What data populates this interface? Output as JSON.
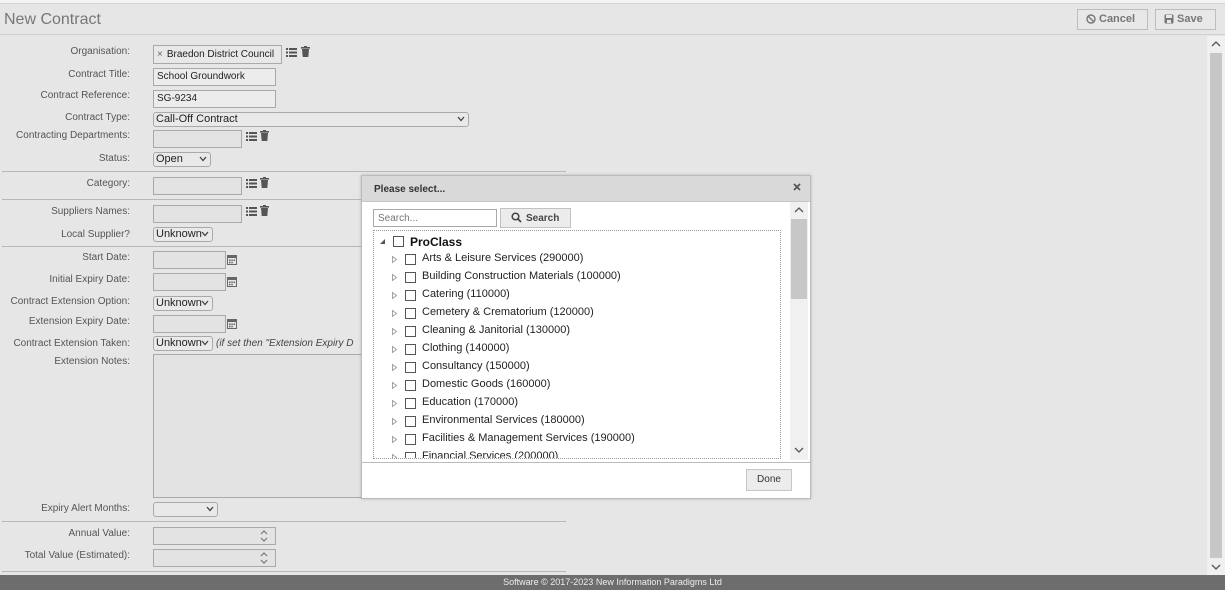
{
  "header": {
    "title": "New Contract",
    "cancel_label": "Cancel",
    "save_label": "Save"
  },
  "form": {
    "organisation": {
      "label": "Organisation:",
      "value": "Braedon District Council",
      "remove": "×"
    },
    "contract_title": {
      "label": "Contract Title:",
      "value": "School Groundwork"
    },
    "contract_reference": {
      "label": "Contract Reference:",
      "value": "SG-9234"
    },
    "contract_type": {
      "label": "Contract Type:",
      "value": "Call-Off Contract"
    },
    "contracting_departments": {
      "label": "Contracting Departments:",
      "value": ""
    },
    "status": {
      "label": "Status:",
      "value": "Open"
    },
    "category": {
      "label": "Category:",
      "value": ""
    },
    "suppliers_names": {
      "label": "Suppliers Names:",
      "value": ""
    },
    "local_supplier": {
      "label": "Local Supplier?",
      "value": "Unknown"
    },
    "start_date": {
      "label": "Start Date:",
      "value": ""
    },
    "initial_expiry_date": {
      "label": "Initial Expiry Date:",
      "value": ""
    },
    "contract_extension_option": {
      "label": "Contract Extension Option:",
      "value": "Unknown"
    },
    "extension_expiry_date": {
      "label": "Extension Expiry Date:",
      "value": ""
    },
    "contract_extension_taken": {
      "label": "Contract Extension Taken:",
      "value": "Unknown",
      "note": "(if set then \"Extension Expiry D"
    },
    "extension_notes": {
      "label": "Extension Notes:",
      "value": ""
    },
    "expiry_alert_months": {
      "label": "Expiry Alert Months:",
      "value": ""
    },
    "annual_value": {
      "label": "Annual Value:",
      "value": ""
    },
    "total_value": {
      "label": "Total Value (Estimated):",
      "value": ""
    }
  },
  "dialog": {
    "title": "Please select...",
    "close": "×",
    "search_placeholder": "Search...",
    "search_label": "Search",
    "done_label": "Done",
    "root": "ProClass",
    "items": [
      {
        "label": "Arts & Leisure Services (290000)"
      },
      {
        "label": "Building Construction Materials (100000)"
      },
      {
        "label": "Catering (110000)"
      },
      {
        "label": "Cemetery & Crematorium (120000)"
      },
      {
        "label": "Cleaning & Janitorial (130000)"
      },
      {
        "label": "Clothing (140000)"
      },
      {
        "label": "Consultancy (150000)"
      },
      {
        "label": "Domestic Goods (160000)"
      },
      {
        "label": "Education (170000)"
      },
      {
        "label": "Environmental Services (180000)"
      },
      {
        "label": "Facilities & Management Services (190000)"
      },
      {
        "label": "Financial Services (200000)"
      }
    ]
  },
  "footer": {
    "text": "Software © 2017-2023 New Information Paradigms Ltd"
  },
  "colors": {
    "background": "#e6e6e6",
    "dialog": "#ffffff",
    "footer": "#6d6d6d"
  }
}
